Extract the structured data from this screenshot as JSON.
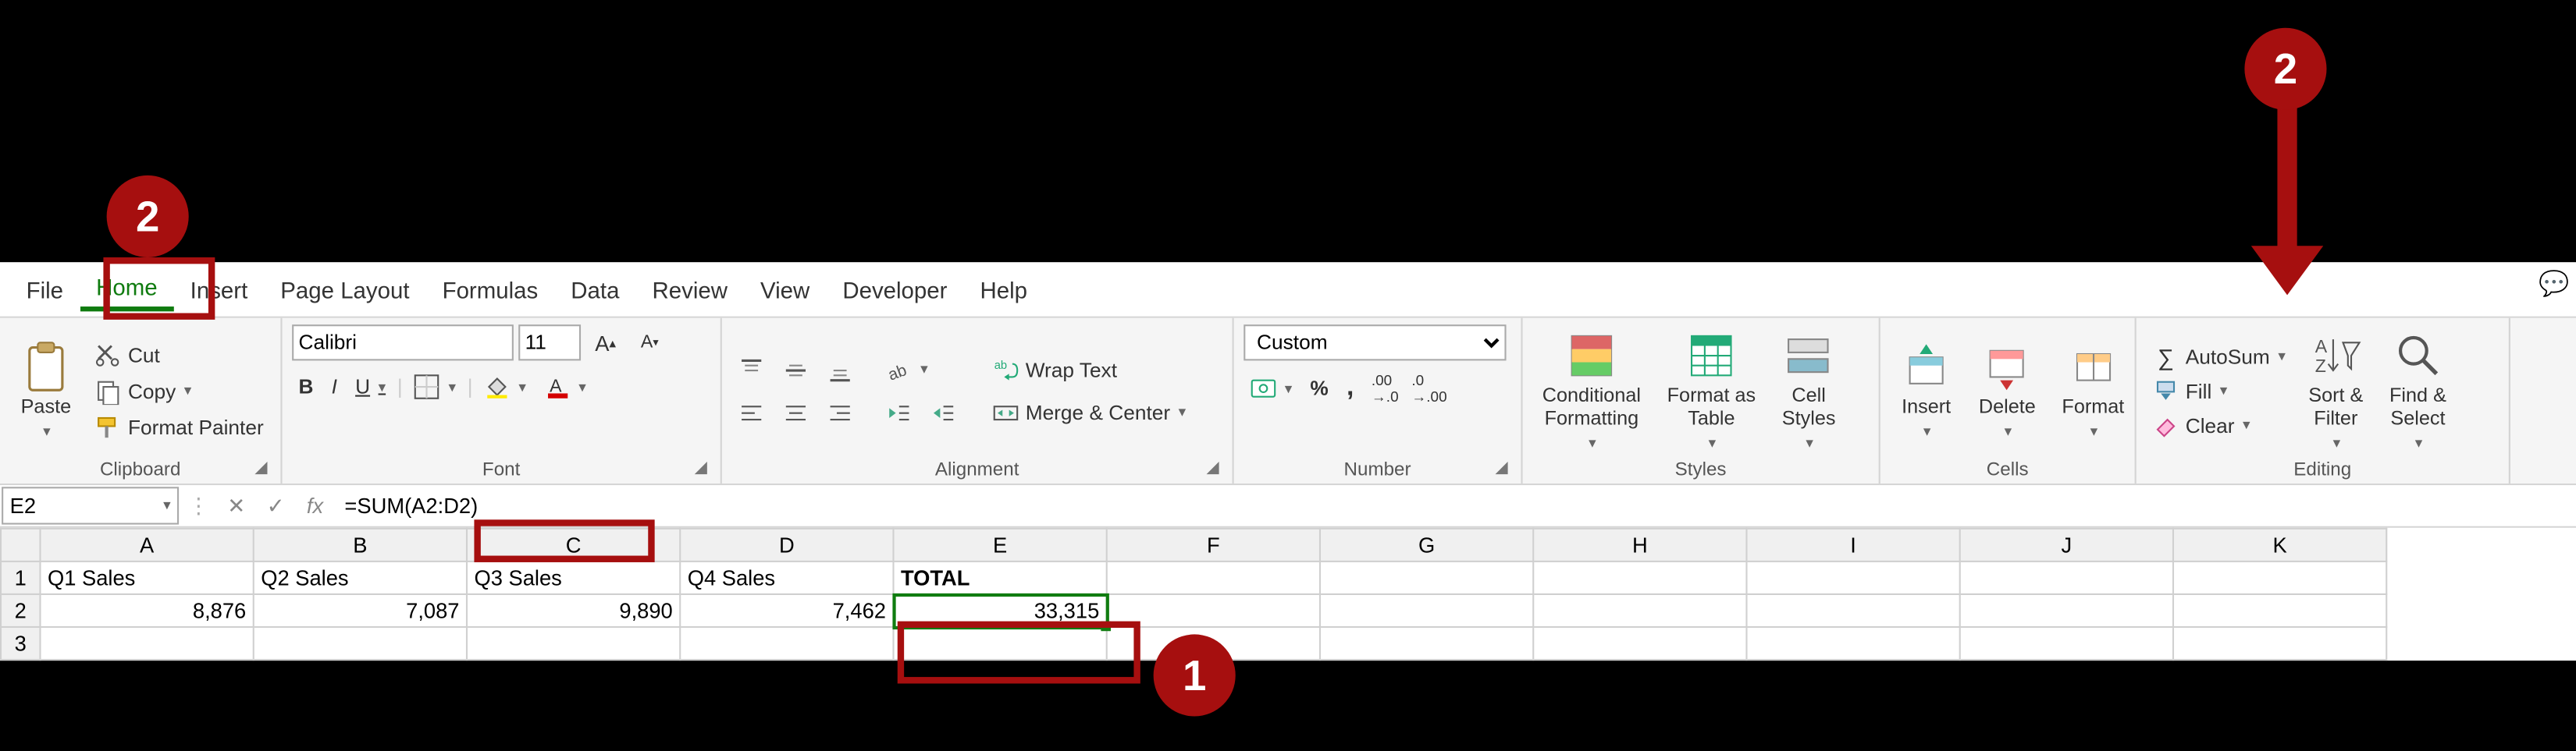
{
  "annotations": {
    "badge_top_left": "2",
    "badge_top_right": "2",
    "badge_cell": "1"
  },
  "tabs": {
    "file": "File",
    "home": "Home",
    "insert": "Insert",
    "page_layout": "Page Layout",
    "formulas": "Formulas",
    "data": "Data",
    "review": "Review",
    "view": "View",
    "developer": "Developer",
    "help": "Help"
  },
  "clipboard": {
    "paste": "Paste",
    "cut": "Cut",
    "copy": "Copy",
    "format_painter": "Format Painter",
    "group": "Clipboard"
  },
  "font": {
    "name": "Calibri",
    "size": "11",
    "bold": "B",
    "italic": "I",
    "underline": "U",
    "group": "Font"
  },
  "alignment": {
    "wrap": "Wrap Text",
    "merge": "Merge & Center",
    "group": "Alignment"
  },
  "number": {
    "format": "Custom",
    "group": "Number"
  },
  "styles": {
    "cond": "Conditional\nFormatting",
    "fat": "Format as\nTable",
    "cellstyles": "Cell\nStyles",
    "group": "Styles"
  },
  "cells": {
    "insert": "Insert",
    "delete": "Delete",
    "format": "Format",
    "group": "Cells"
  },
  "editing": {
    "autosum": "AutoSum",
    "fill": "Fill",
    "clear": "Clear",
    "sort": "Sort &\nFilter",
    "find": "Find &\nSelect",
    "group": "Editing"
  },
  "formula_bar": {
    "cell_ref": "E2",
    "formula": "=SUM(A2:D2)"
  },
  "sheet": {
    "columns": [
      "A",
      "B",
      "C",
      "D",
      "E",
      "F",
      "G",
      "H",
      "I",
      "J",
      "K"
    ],
    "rows": [
      {
        "num": "1",
        "cells": [
          "Q1 Sales",
          "Q2 Sales",
          "Q3 Sales",
          "Q4 Sales",
          "TOTAL",
          "",
          "",
          "",
          "",
          "",
          ""
        ]
      },
      {
        "num": "2",
        "cells": [
          "8,876",
          "7,087",
          "9,890",
          "7,462",
          "33,315",
          "",
          "",
          "",
          "",
          "",
          ""
        ]
      },
      {
        "num": "3",
        "cells": [
          "",
          "",
          "",
          "",
          "",
          "",
          "",
          "",
          "",
          "",
          ""
        ]
      }
    ]
  },
  "chart_data": {
    "type": "table",
    "headers": [
      "Q1 Sales",
      "Q2 Sales",
      "Q3 Sales",
      "Q4 Sales",
      "TOTAL"
    ],
    "rows": [
      [
        8876,
        7087,
        9890,
        7462,
        33315
      ]
    ],
    "formula_cell": {
      "ref": "E2",
      "formula": "=SUM(A2:D2)",
      "value": 33315
    }
  }
}
